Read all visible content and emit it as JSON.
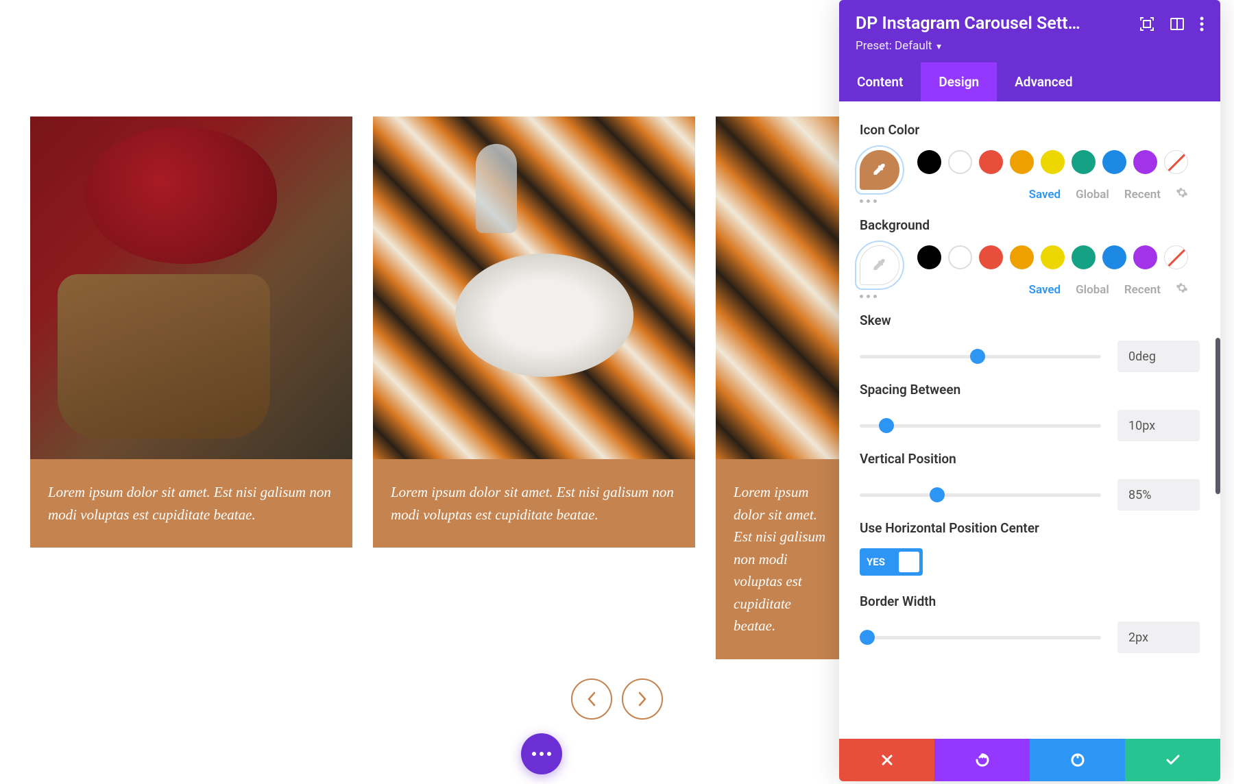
{
  "carousel": {
    "cards": [
      {
        "caption": "Lorem ipsum dolor sit amet. Est nisi galisum non modi voluptas est cupiditate beatae."
      },
      {
        "caption": "Lorem ipsum dolor sit amet. Est nisi galisum non modi voluptas est cupiditate beatae."
      },
      {
        "caption": "Lorem ipsum dolor sit amet. Est nisi galisum non modi voluptas est cupiditate beatae."
      }
    ]
  },
  "panel": {
    "title": "DP Instagram Carousel Sett…",
    "preset": "Preset: Default",
    "tabs": {
      "content": "Content",
      "design": "Design",
      "advanced": "Advanced"
    },
    "sections": {
      "icon_color": "Icon Color",
      "background": "Background",
      "skew": "Skew",
      "spacing_between": "Spacing Between",
      "vertical_position": "Vertical Position",
      "use_horizontal": "Use Horizontal Position Center",
      "border_width": "Border Width"
    },
    "color_tabs": {
      "saved": "Saved",
      "global": "Global",
      "recent": "Recent"
    },
    "palette": [
      "#000000",
      "#ffffff",
      "#e84e3c",
      "#eda000",
      "#ecd700",
      "#15a184",
      "#1e88e5",
      "#a233e8"
    ],
    "values": {
      "skew": "0deg",
      "spacing": "10px",
      "vertical": "85%",
      "border": "2px",
      "toggle": "YES"
    },
    "slider_positions": {
      "skew_pct": 49,
      "spacing_pct": 11,
      "vertical_pct": 32,
      "border_pct": 3
    }
  }
}
